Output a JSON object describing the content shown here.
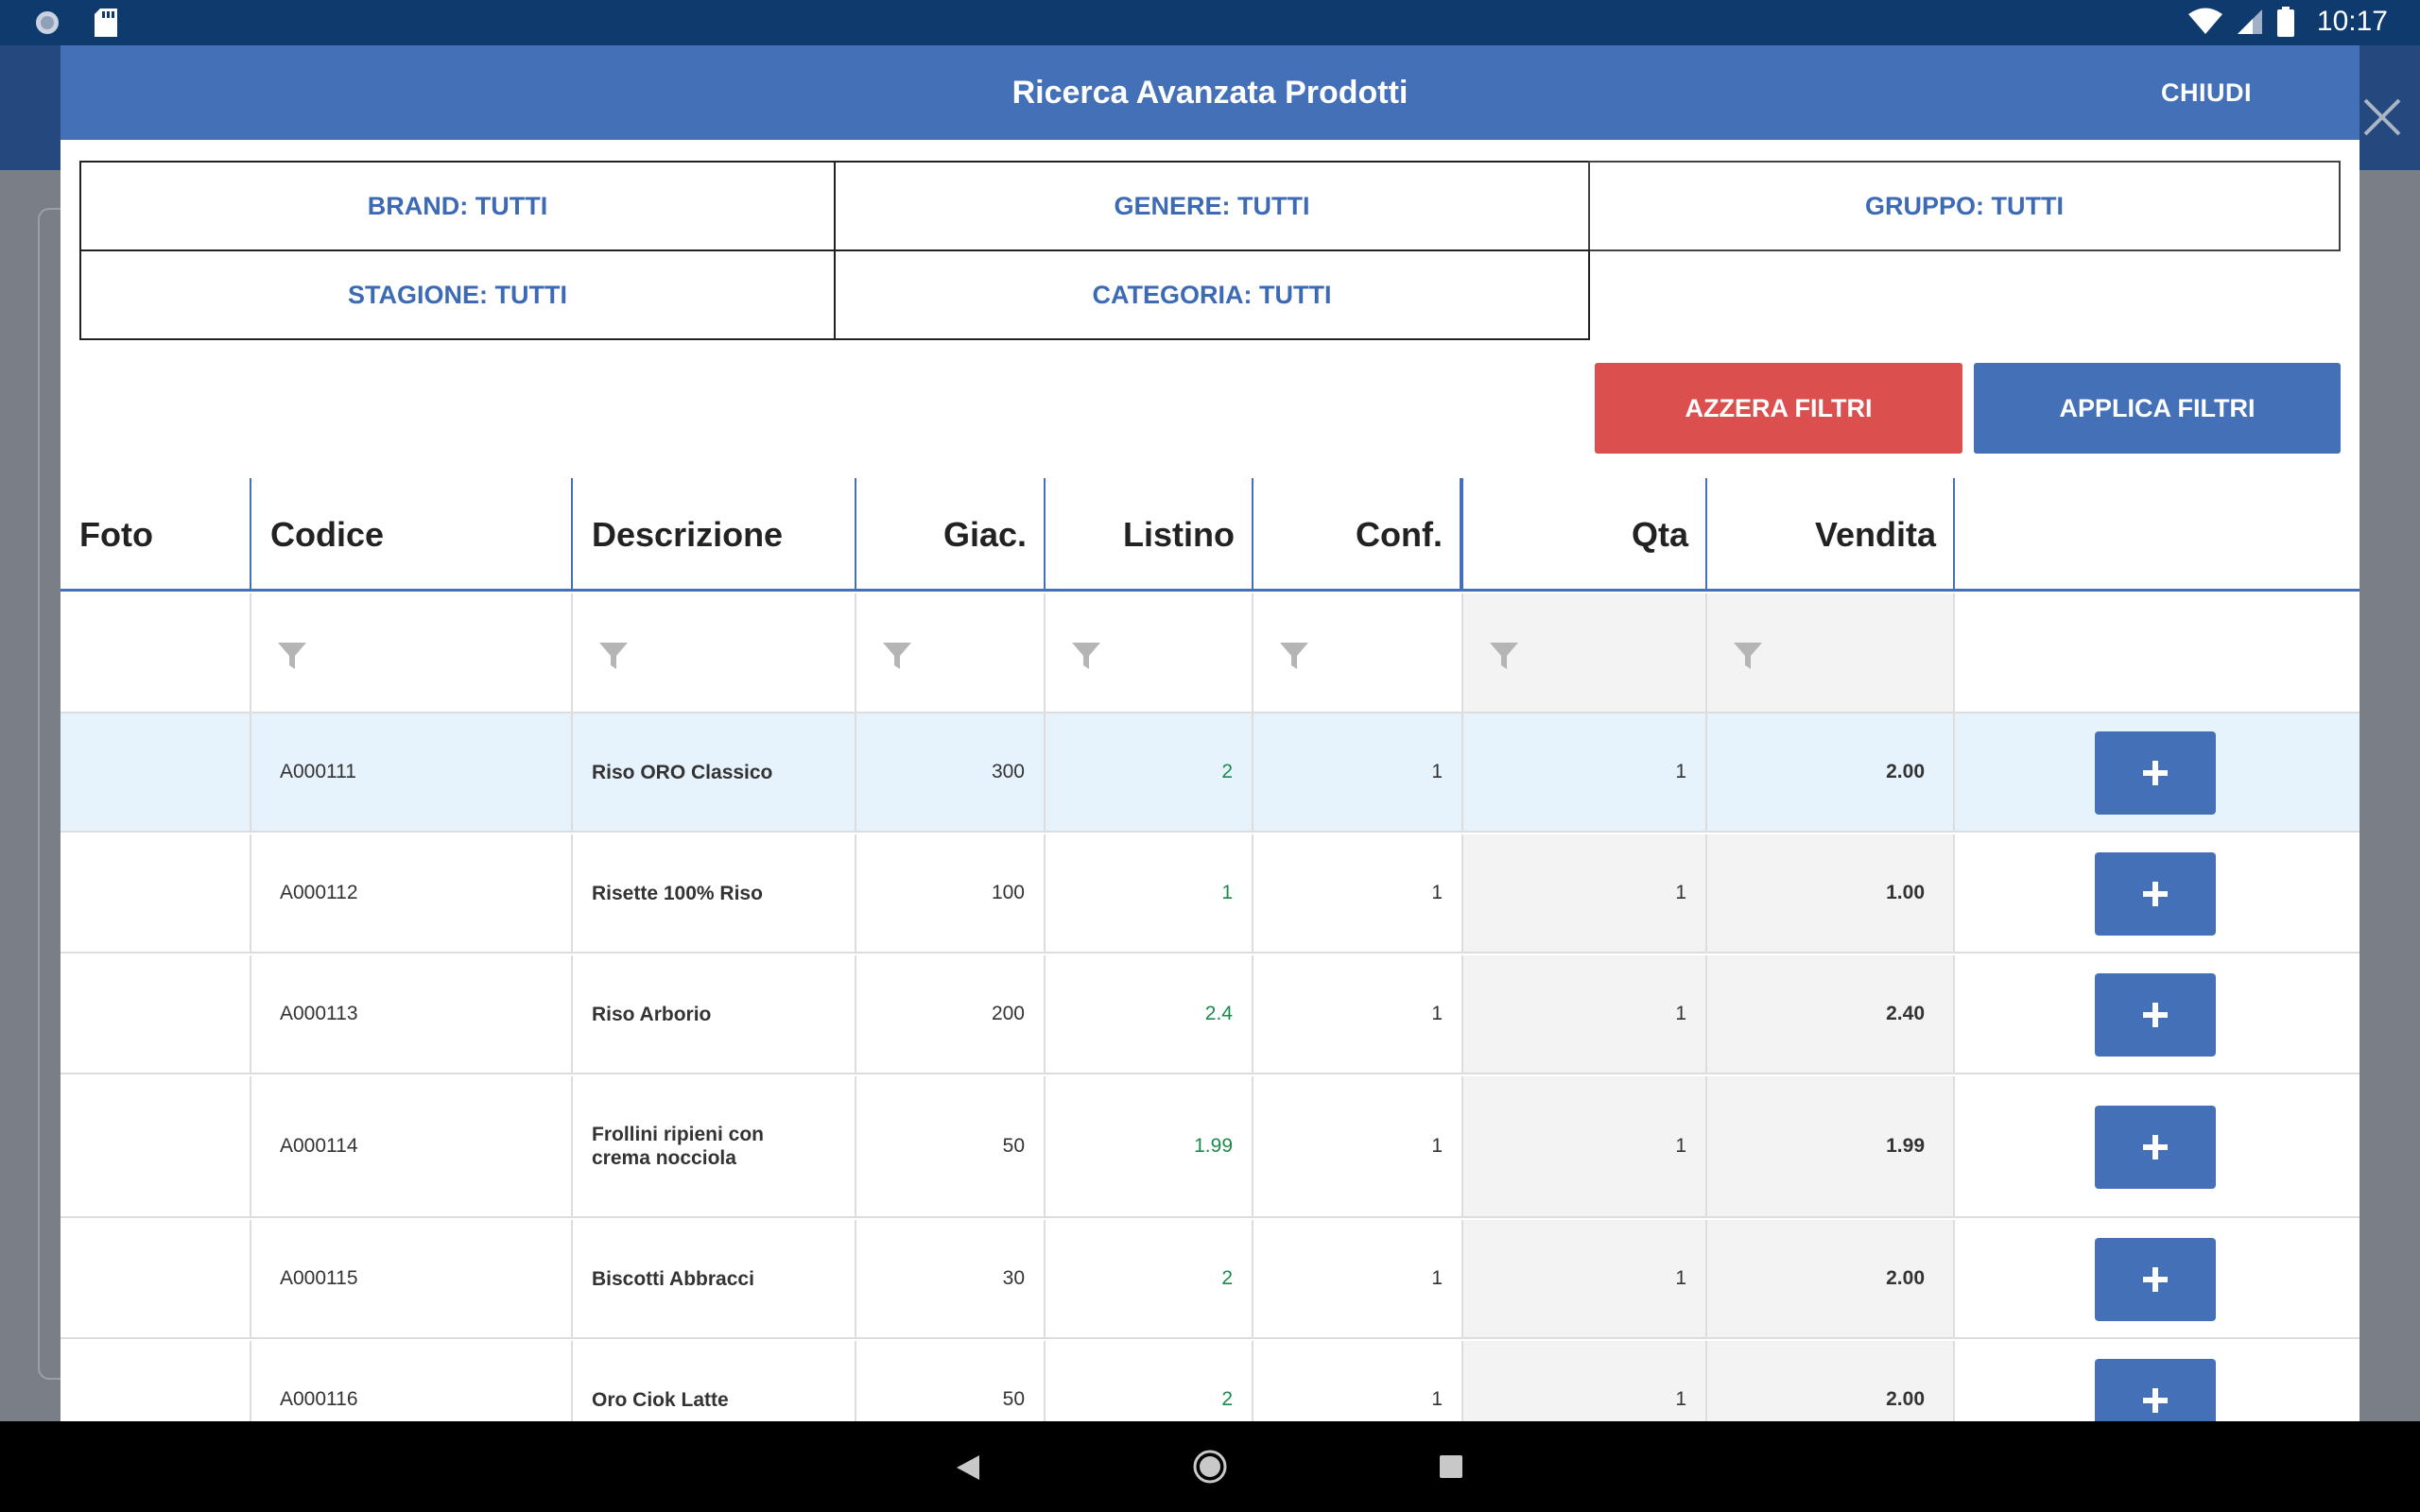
{
  "status_bar": {
    "time": "10:17",
    "left_icons": [
      "notification-icon",
      "sd-card-icon"
    ],
    "right_icons": [
      "wifi-icon",
      "signal-icon",
      "battery-icon"
    ]
  },
  "dialog": {
    "title": "Ricerca Avanzata Prodotti",
    "close_label": "CHIUDI"
  },
  "filters": [
    {
      "label": "BRAND: TUTTI"
    },
    {
      "label": "GENERE: TUTTI"
    },
    {
      "label": "GRUPPO: TUTTI"
    },
    {
      "label": "STAGIONE: TUTTI"
    },
    {
      "label": "CATEGORIA: TUTTI"
    }
  ],
  "actions": {
    "reset_label": "AZZERA FILTRI",
    "apply_label": "APPLICA FILTRI"
  },
  "table": {
    "columns": [
      "Foto",
      "Codice",
      "Descrizione",
      "Giac.",
      "Listino",
      "Conf.",
      "Qta",
      "Vendita"
    ],
    "rows": [
      {
        "code": "A000111",
        "desc": "Riso ORO Classico",
        "giac": "300",
        "listino": "2",
        "conf": "1",
        "qta": "1",
        "vendita": "2.00",
        "selected": true
      },
      {
        "code": "A000112",
        "desc": "Risette 100% Riso",
        "giac": "100",
        "listino": "1",
        "conf": "1",
        "qta": "1",
        "vendita": "1.00"
      },
      {
        "code": "A000113",
        "desc": "Riso Arborio",
        "giac": "200",
        "listino": "2.4",
        "conf": "1",
        "qta": "1",
        "vendita": "2.40"
      },
      {
        "code": "A000114",
        "desc": "Frollini ripieni con crema nocciola",
        "giac": "50",
        "listino": "1.99",
        "conf": "1",
        "qta": "1",
        "vendita": "1.99"
      },
      {
        "code": "A000115",
        "desc": "Biscotti Abbracci",
        "giac": "30",
        "listino": "2",
        "conf": "1",
        "qta": "1",
        "vendita": "2.00"
      },
      {
        "code": "A000116",
        "desc": "Oro Ciok Latte",
        "giac": "50",
        "listino": "2",
        "conf": "1",
        "qta": "1",
        "vendita": "2.00"
      }
    ]
  },
  "colors": {
    "primary": "#4470b8",
    "danger": "#dc4f4f",
    "status_bar": "#0e3a6e",
    "price_green": "#1b8a4a"
  }
}
